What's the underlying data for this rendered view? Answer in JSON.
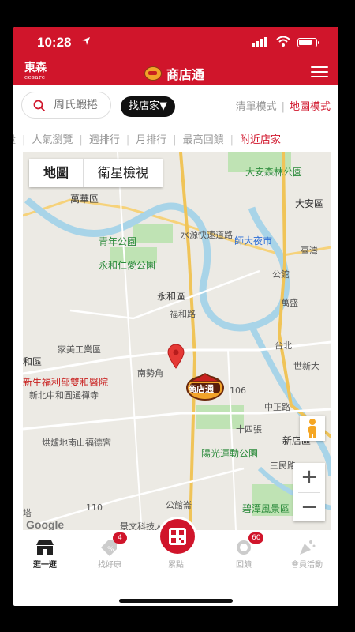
{
  "status": {
    "time": "10:28",
    "battery_level": 0.8
  },
  "header": {
    "logo_main": "東森",
    "logo_sub": "eesare",
    "title": "商店通"
  },
  "search": {
    "placeholder": "周氏蝦捲",
    "find_store_label": "找店家▼"
  },
  "modes": {
    "list_label": "清單模式",
    "separator": "|",
    "map_label": "地圖模式",
    "active": "map"
  },
  "tabs": [
    {
      "label": "量"
    },
    {
      "label": "人氣瀏覽"
    },
    {
      "label": "週排行"
    },
    {
      "label": "月排行"
    },
    {
      "label": "最高回饋"
    },
    {
      "label": "附近店家",
      "active": true
    }
  ],
  "tab_separator": "|",
  "map": {
    "toggle": {
      "map_label": "地圖",
      "satellite_label": "衛星檢視"
    },
    "zoom_in": "+",
    "zoom_out": "−",
    "attribution": "Google",
    "marker_label": "商店通",
    "labels": [
      {
        "text": "大安森林公園",
        "cls": "green"
      },
      {
        "text": "萬華區",
        "cls": "big"
      },
      {
        "text": "大安區",
        "cls": "big"
      },
      {
        "text": "青年公園",
        "cls": "green"
      },
      {
        "text": "師大夜市",
        "cls": "blue"
      },
      {
        "text": "臺灣",
        "cls": ""
      },
      {
        "text": "永和仁愛公園",
        "cls": "green"
      },
      {
        "text": "公館",
        "cls": ""
      },
      {
        "text": "萬盛",
        "cls": ""
      },
      {
        "text": "永和區",
        "cls": "big"
      },
      {
        "text": "福和路",
        "cls": ""
      },
      {
        "text": "家美工業區",
        "cls": ""
      },
      {
        "text": "和區",
        "cls": "big"
      },
      {
        "text": "台北",
        "cls": ""
      },
      {
        "text": "世新大",
        "cls": ""
      },
      {
        "text": "新生福利部雙和醫院",
        "cls": "red"
      },
      {
        "text": "新北中和圓通禪寺",
        "cls": ""
      },
      {
        "text": "南勢角",
        "cls": ""
      },
      {
        "text": "中正路",
        "cls": ""
      },
      {
        "text": "十四張",
        "cls": ""
      },
      {
        "text": "烘爐地南山福德宮",
        "cls": ""
      },
      {
        "text": "陽光運動公園",
        "cls": "green"
      },
      {
        "text": "新店區",
        "cls": "big"
      },
      {
        "text": "三民路",
        "cls": ""
      },
      {
        "text": "塔",
        "cls": ""
      },
      {
        "text": "公館崙",
        "cls": ""
      },
      {
        "text": "碧潭風景區",
        "cls": "green"
      },
      {
        "text": "景文科技大學",
        "cls": ""
      },
      {
        "text": "水源快速道路",
        "cls": ""
      },
      {
        "text": "106",
        "cls": ""
      },
      {
        "text": "110",
        "cls": ""
      }
    ]
  },
  "bottom_nav": [
    {
      "label": "逛一逛",
      "icon": "storefront-icon",
      "active": true
    },
    {
      "label": "找好康",
      "icon": "discount-tag-icon",
      "badge": "4"
    },
    {
      "label": "累點",
      "icon": "qr-code-icon"
    },
    {
      "label": "回饋",
      "icon": "coin-icon",
      "badge": "60"
    },
    {
      "label": "會員活動",
      "icon": "party-popper-icon"
    }
  ],
  "colors": {
    "brand_red": "#d0152b",
    "map_bg": "#eceae4",
    "water": "#a8d4e8",
    "park": "#bfe3b4"
  }
}
